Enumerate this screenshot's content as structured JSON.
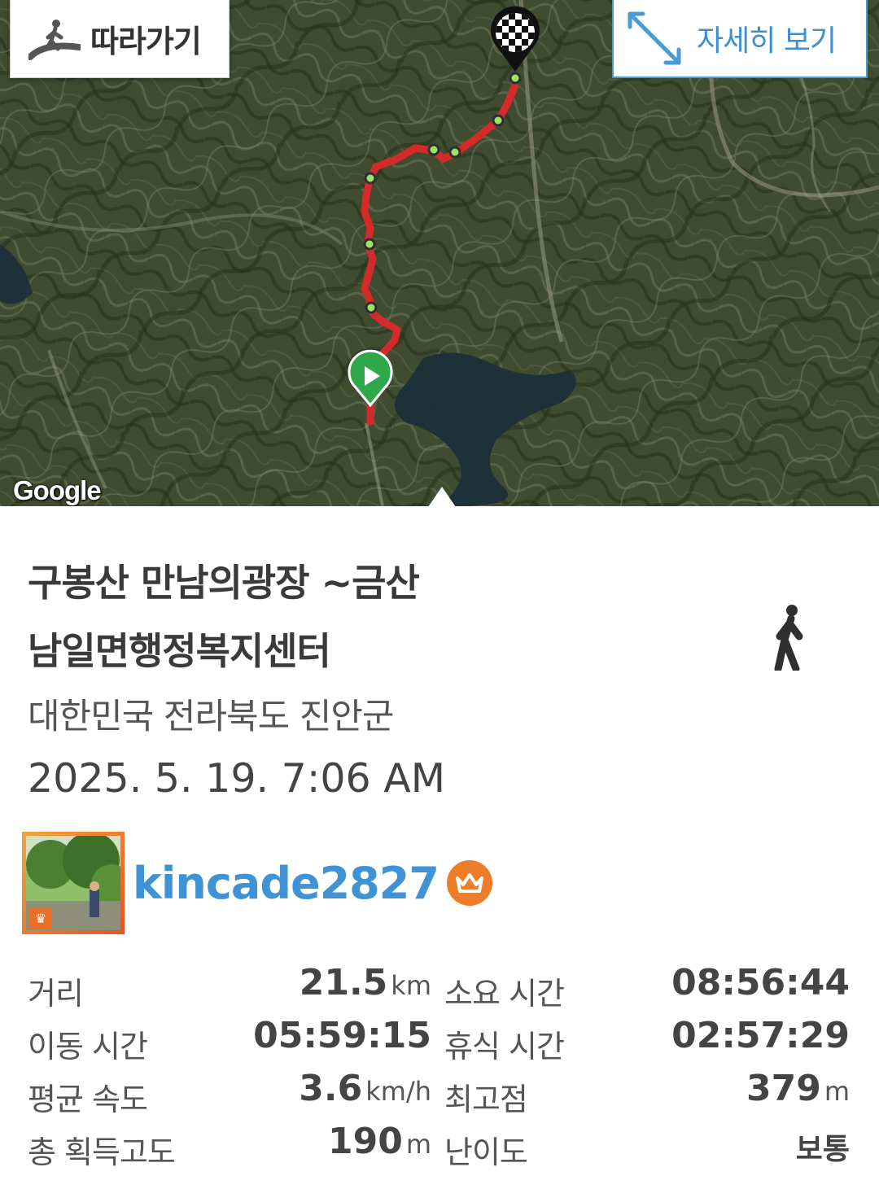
{
  "map": {
    "follow_label": "따라가기",
    "detail_label": "자세히 보기",
    "google_label": "Google",
    "start_marker_icon": "play-icon",
    "end_marker_icon": "checkered-flag-icon",
    "route_color": "#d42a2a",
    "waypoint_color": "#9be36a"
  },
  "track": {
    "title_line1": "구봉산 만남의광장 ~금산",
    "title_line2": "남일면행정복지센터",
    "activity_icon": "walking-person-icon",
    "location": "대한민국 전라북도 진안군",
    "datetime": "2025. 5. 19. 7:06 AM"
  },
  "user": {
    "name": "kincade2827",
    "badge_icon": "crown-icon",
    "accent_color": "#3f93d4"
  },
  "stats": {
    "distance_label": "거리",
    "distance_value": "21.5",
    "distance_unit": "km",
    "total_time_label": "소요 시간",
    "total_time_value": "08:56:44",
    "moving_time_label": "이동 시간",
    "moving_time_value": "05:59:15",
    "rest_time_label": "휴식 시간",
    "rest_time_value": "02:57:29",
    "avg_speed_label": "평균 속도",
    "avg_speed_value": "3.6",
    "avg_speed_unit": "km/h",
    "max_alt_label": "최고점",
    "max_alt_value": "379",
    "max_alt_unit": "m",
    "elev_gain_label": "총 획득고도",
    "elev_gain_value": "190",
    "elev_gain_unit": "m",
    "difficulty_label": "난이도",
    "difficulty_value": "보통"
  }
}
